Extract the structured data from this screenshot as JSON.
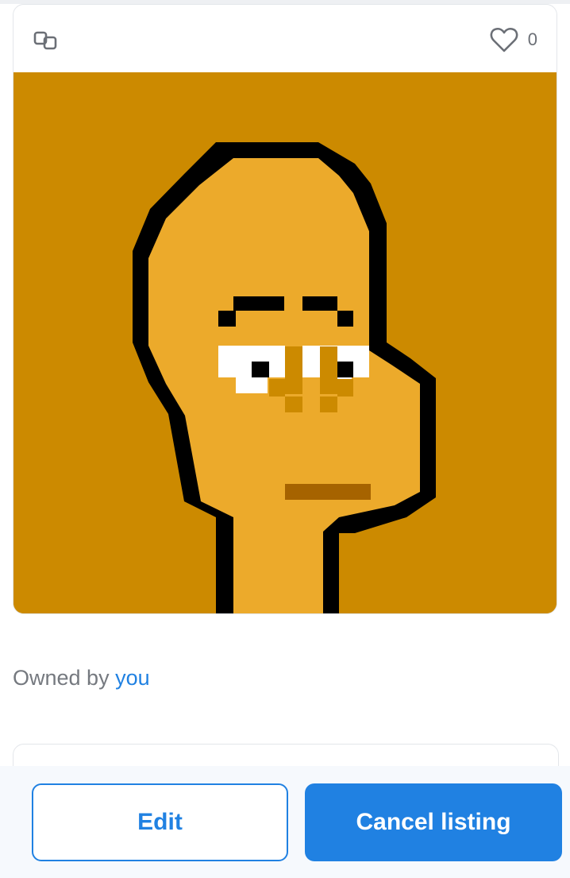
{
  "header": {
    "chain_icon": "polygon-link-icon",
    "favorite_icon": "heart-outline-icon",
    "favorite_count": "0"
  },
  "artwork": {
    "description_icon": "pixel-art-character",
    "background_color": "#cc8a00",
    "skin_color": "#ecaa2b",
    "outline_color": "#000000"
  },
  "owner": {
    "prefix": "Owned by",
    "name": "you"
  },
  "actions": {
    "edit_label": "Edit",
    "cancel_label": "Cancel listing"
  },
  "colors": {
    "accent": "#2081e2"
  }
}
